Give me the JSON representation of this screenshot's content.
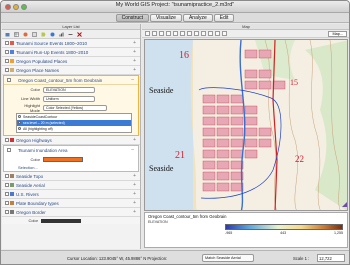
{
  "window": {
    "title": "My World GIS Project: \"tsunamipractice_2.m3rd\""
  },
  "tabs": [
    "Construct",
    "Visualize",
    "Analyze",
    "Edit"
  ],
  "left_panel": {
    "header": "Layer List",
    "layers_top": [
      {
        "label": "Tsunami Source  Events 1800–2010",
        "color": "#e05a4f"
      },
      {
        "label": "Tsunami Run-Up Events 1800–2010",
        "color": "#4f7fe0"
      },
      {
        "label": "Oregon Populated Places",
        "color": "#f0a030"
      },
      {
        "label": "Oregon Place Names",
        "color": "#d0b070"
      }
    ],
    "expanded": {
      "title": "Oregon Coast_contour_5m from Geobrain",
      "color_label": "Color",
      "color_value": "ELEVATION",
      "linewidth_label": "Line Width",
      "linewidth_value": "Uniform",
      "highlight_label": "Highlight Mode",
      "highlight_value": "Color Selected (Yellow)",
      "list": [
        {
          "label": "SeasideCoastContour",
          "selected": false
        },
        {
          "label": "sea level – 20 m (selected)",
          "selected": true
        },
        {
          "label": "All (highlighting off)",
          "selected": false
        }
      ]
    },
    "layers_mid": [
      {
        "label": "Oregon Highways",
        "color": "#cc3333"
      }
    ],
    "inundation": {
      "title": "Tsunami Inundation Area",
      "color_label": "Color",
      "selection_label": "Selection..."
    },
    "layers_bottom": [
      {
        "label": "Seaside Topo",
        "color": "#a08060"
      },
      {
        "label": "Seaside Aerial",
        "color": "#7a9a6a"
      },
      {
        "label": "U.S. Rivers",
        "color": "#4a7ad0"
      },
      {
        "label": "Plate Boundary types",
        "color": "#c08040"
      },
      {
        "label": "Oregon Border",
        "color": "#777777"
      }
    ],
    "border_color_label": "Color"
  },
  "map_panel": {
    "header": "Map",
    "map_select": "Map...",
    "place_labels": [
      "Seaside",
      "Seaside"
    ],
    "legend_title": "Oregon Coast_contour_5m from Geobrain",
    "legend_sub": "ELEVATION",
    "ramp_ticks": [
      "-965",
      "443",
      "1,255"
    ]
  },
  "status_bar": {
    "cursor_label": "Cursor Location: 123.9045° W, 45.9886° N  Projection:",
    "basemap": "Match Seaside Aerial",
    "scale_label": "Scale 1 :",
    "scale_value": "12,722"
  }
}
